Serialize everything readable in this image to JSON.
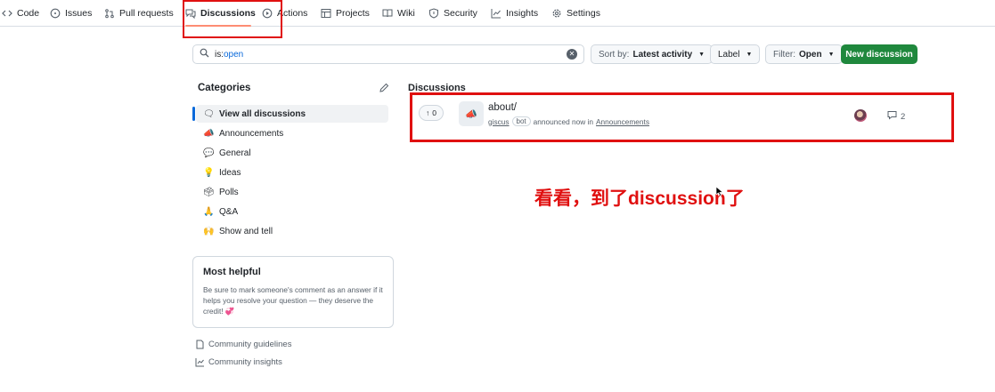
{
  "nav": {
    "tabs": [
      {
        "label": "Code",
        "icon": "code-icon"
      },
      {
        "label": "Issues",
        "icon": "issue-opened-icon"
      },
      {
        "label": "Pull requests",
        "icon": "git-pull-request-icon"
      },
      {
        "label": "Discussions",
        "icon": "comment-discussion-icon",
        "selected": true
      },
      {
        "label": "Actions",
        "icon": "play-icon"
      },
      {
        "label": "Projects",
        "icon": "table-icon"
      },
      {
        "label": "Wiki",
        "icon": "book-icon"
      },
      {
        "label": "Security",
        "icon": "shield-icon"
      },
      {
        "label": "Insights",
        "icon": "graph-icon"
      },
      {
        "label": "Settings",
        "icon": "gear-icon"
      }
    ]
  },
  "search": {
    "prefix": "is:",
    "value": "open"
  },
  "toolbar": {
    "sort_label": "Sort by:",
    "sort_value": "Latest activity",
    "label_button": "Label",
    "filter_label": "Filter:",
    "filter_value": "Open",
    "new_discussion": "New discussion"
  },
  "sidebar": {
    "title": "Categories",
    "items": [
      {
        "emoji": "🗨",
        "label": "View all discussions"
      },
      {
        "emoji": "📣",
        "label": "Announcements"
      },
      {
        "emoji": "💬",
        "label": "General"
      },
      {
        "emoji": "💡",
        "label": "Ideas"
      },
      {
        "emoji": "🗳",
        "label": "Polls"
      },
      {
        "emoji": "🙏",
        "label": "Q&A"
      },
      {
        "emoji": "🙌",
        "label": "Show and tell"
      }
    ],
    "most_helpful": {
      "title": "Most helpful",
      "text": "Be sure to mark someone's comment as an answer if it helps you resolve your question — they deserve the credit! 💞"
    },
    "links": [
      "Community guidelines",
      "Community insights"
    ]
  },
  "discussions": {
    "title": "Discussions",
    "rows": [
      {
        "votes": "0",
        "category_emoji": "📣",
        "title": "about/",
        "author": "giscus",
        "badge": "bot",
        "meta": "announced now in",
        "category": "Announcements",
        "comments": "2"
      }
    ]
  },
  "annotation": "看看，到了discussion了",
  "colors": {
    "accent": "#0969da",
    "primary_button": "#1f883d",
    "annotation_red": "#e01010",
    "tab_underline": "#fd8c73"
  }
}
